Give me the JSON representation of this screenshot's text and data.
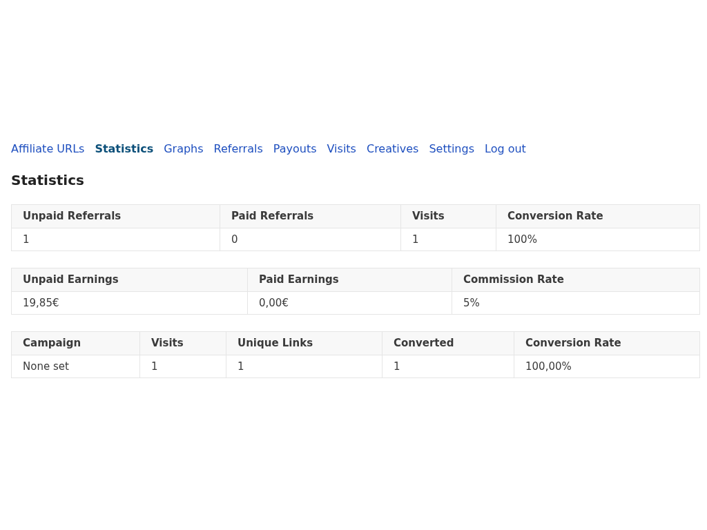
{
  "nav": [
    {
      "label": "Affiliate URLs",
      "selected": false
    },
    {
      "label": "Statistics",
      "selected": true
    },
    {
      "label": "Graphs",
      "selected": false
    },
    {
      "label": "Referrals",
      "selected": false
    },
    {
      "label": "Payouts",
      "selected": false
    },
    {
      "label": "Visits",
      "selected": false
    },
    {
      "label": "Creatives",
      "selected": false
    },
    {
      "label": "Settings",
      "selected": false
    },
    {
      "label": "Log out",
      "selected": false
    }
  ],
  "heading": "Statistics",
  "tables": [
    {
      "columns": [
        "Unpaid Referrals",
        "Paid Referrals",
        "Visits",
        "Conversion Rate"
      ],
      "rows": [
        [
          "1",
          "0",
          "1",
          "100%"
        ]
      ]
    },
    {
      "columns": [
        "Unpaid Earnings",
        "Paid Earnings",
        "Commission Rate"
      ],
      "rows": [
        [
          "19,85€",
          "0,00€",
          "5%"
        ]
      ]
    },
    {
      "columns": [
        "Campaign",
        "Visits",
        "Unique Links",
        "Converted",
        "Conversion Rate"
      ],
      "rows": [
        [
          "None set",
          "1",
          "1",
          "1",
          "100,00%"
        ]
      ]
    }
  ]
}
